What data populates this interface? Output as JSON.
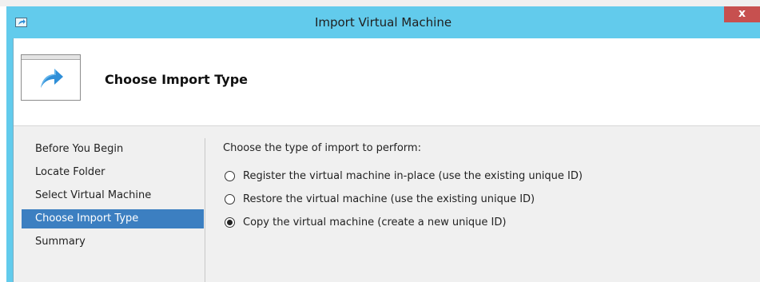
{
  "window": {
    "title": "Import Virtual Machine",
    "close_label": "x"
  },
  "header": {
    "title": "Choose Import Type"
  },
  "sidebar": {
    "items": [
      {
        "label": "Before You Begin",
        "active": false
      },
      {
        "label": "Locate Folder",
        "active": false
      },
      {
        "label": "Select Virtual Machine",
        "active": false
      },
      {
        "label": "Choose Import Type",
        "active": true
      },
      {
        "label": "Summary",
        "active": false
      }
    ]
  },
  "main": {
    "prompt": "Choose the type of import to perform:",
    "options": [
      {
        "label": "Register the virtual machine in-place (use the existing unique ID)",
        "selected": false
      },
      {
        "label": "Restore the virtual machine (use the existing unique ID)",
        "selected": false
      },
      {
        "label": "Copy the virtual machine (create a new unique ID)",
        "selected": true
      }
    ]
  },
  "colors": {
    "titlebar": "#62cbec",
    "selection": "#3c7fc1",
    "close": "#c7504f",
    "arrow": "#2f8fd8"
  }
}
